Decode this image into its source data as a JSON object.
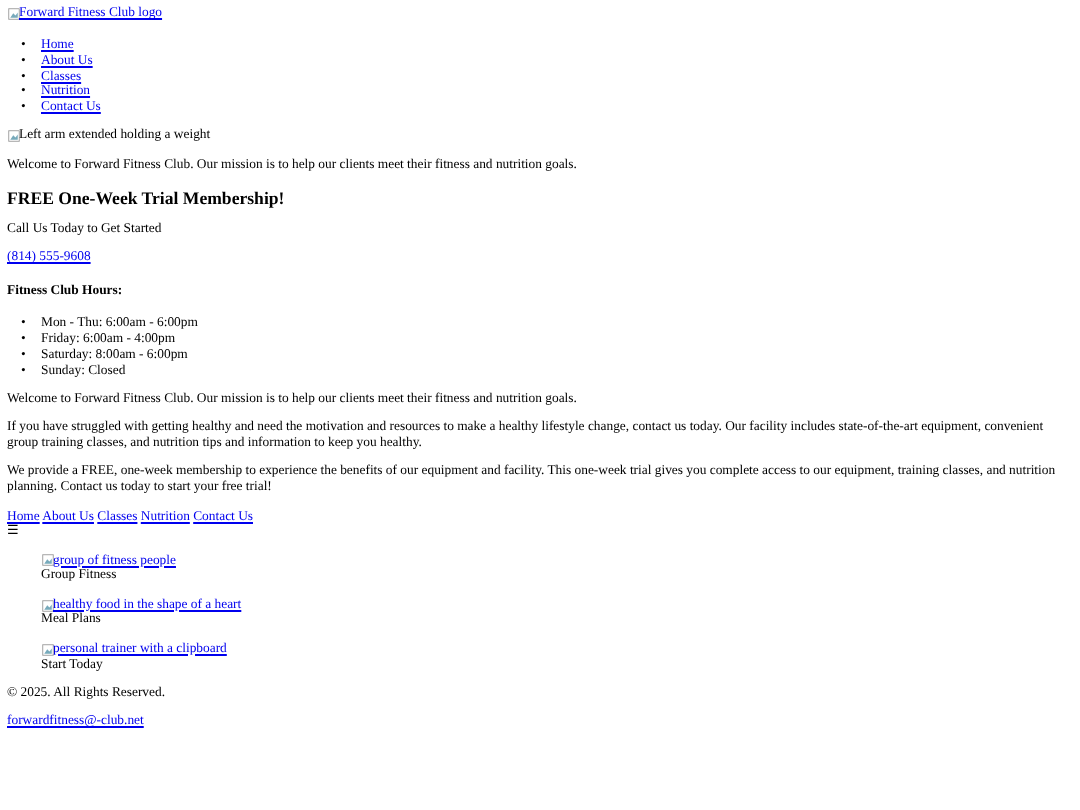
{
  "list_marker": "•",
  "logo": {
    "alt": "Forward Fitness Club logo"
  },
  "nav": [
    "Home",
    "About Us",
    "Classes",
    "Nutrition",
    "Contact Us"
  ],
  "hero_image": {
    "alt": "Left arm extended holding a weight"
  },
  "intro": "Welcome to Forward Fitness Club. Our mission is to help our clients meet their fitness and nutrition goals.",
  "trial": {
    "heading": "FREE One-Week Trial Membership!",
    "subheading": "Call Us Today to Get Started",
    "phone": "(814) 555-9608"
  },
  "hours": {
    "heading": "Fitness Club Hours:",
    "items": [
      "Mon - Thu: 6:00am - 6:00pm",
      "Friday: 6:00am - 4:00pm",
      "Saturday: 8:00am - 6:00pm",
      "Sunday: Closed"
    ]
  },
  "paragraphs": [
    "Welcome to Forward Fitness Club. Our mission is to help our clients meet their fitness and nutrition goals.",
    "If you have struggled with getting healthy and need the motivation and resources to make a healthy lifestyle change, contact us today. Our facility includes state-of-the-art equipment, convenient group training classes, and nutrition tips and information to keep you healthy.",
    "We provide a FREE, one-week membership to experience the benefits of our equipment and facility. This one-week trial gives you complete access to our equipment, training classes, and nutrition planning. Contact us today to start your free trial!"
  ],
  "footer_nav": [
    "Home",
    "About Us",
    "Classes",
    "Nutrition",
    "Contact Us"
  ],
  "menu_icon": "☰",
  "features": [
    {
      "image_alt": "group of fitness people",
      "caption": "Group Fitness"
    },
    {
      "image_alt": "healthy food in the shape of a heart",
      "caption": "Meal Plans"
    },
    {
      "image_alt": "personal trainer with a clipboard",
      "caption": "Start Today"
    }
  ],
  "copyright": "© 2025. All Rights Reserved.",
  "email": "forwardfitness@-club.net"
}
